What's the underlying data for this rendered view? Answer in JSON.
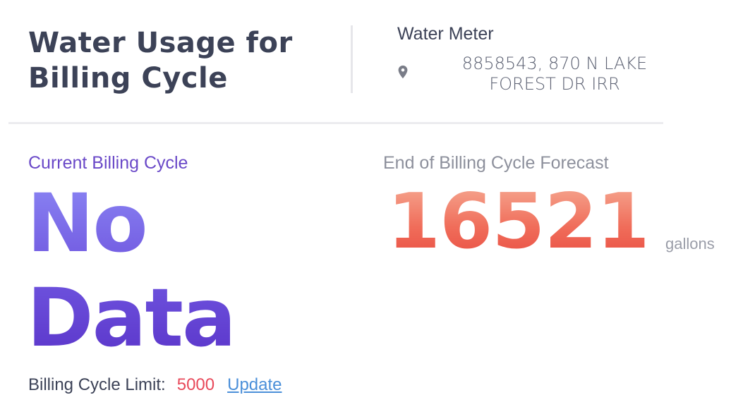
{
  "header": {
    "title": "Water Usage for Billing Cycle",
    "meter_label": "Water Meter",
    "location_icon": "map-pin-icon",
    "meter_address": "8858543, 870 N LAKE FOREST DR IRR"
  },
  "current": {
    "label": "Current Billing Cycle",
    "value": "No Data"
  },
  "forecast": {
    "label": "End of Billing Cycle Forecast",
    "value": "16521",
    "unit": "gallons"
  },
  "limit": {
    "label": "Billing Cycle Limit:",
    "value": "5000",
    "update_label": "Update"
  },
  "colors": {
    "current_value": "#6d52dd",
    "current_label": "#6a49c8",
    "forecast_value": "#f06d5a",
    "limit_value": "#e8495a",
    "link": "#4a8fd9"
  }
}
